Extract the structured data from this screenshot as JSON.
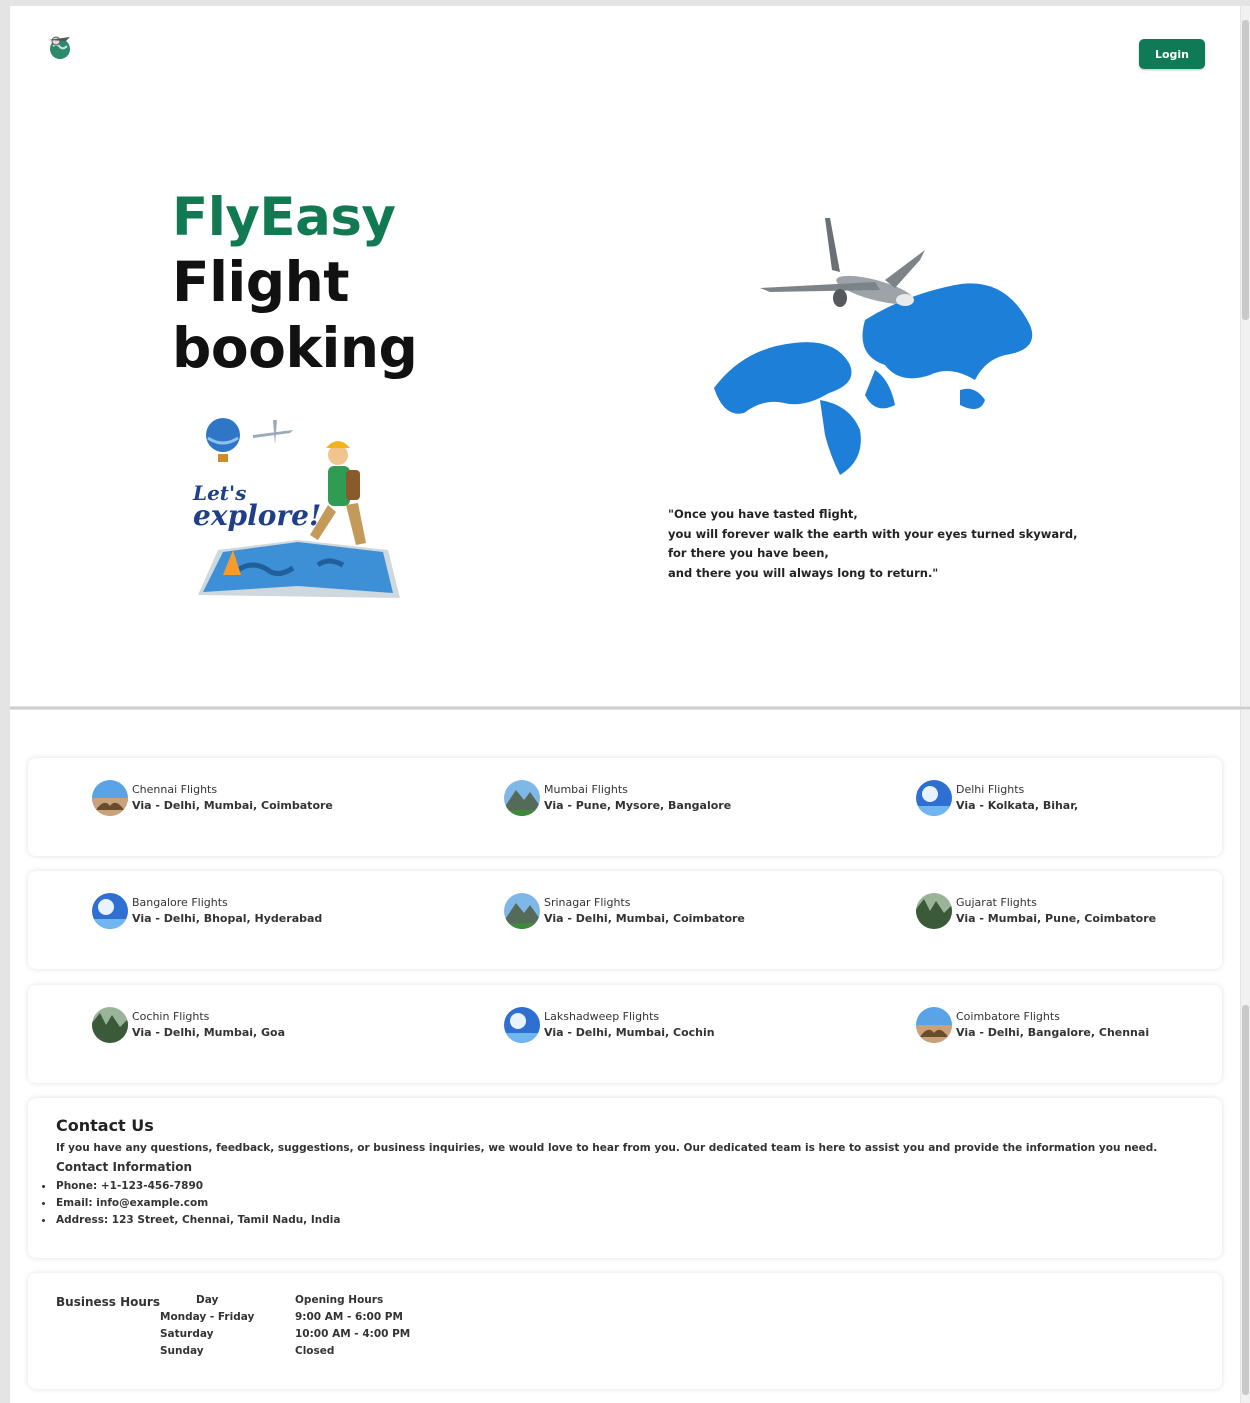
{
  "header": {
    "logo_icon": "airplane-globe-icon",
    "login_label": "Login"
  },
  "hero": {
    "brand": "FlyEasy",
    "title_line1": "Flight",
    "title_line2": "booking",
    "illustration_text": "Let's explore!",
    "quote": [
      "\"Once you have tasted flight,",
      "you will forever walk the earth with your eyes turned skyward,",
      "for there you have been,",
      "and there you will always long to return.\""
    ]
  },
  "routes": [
    [
      {
        "title": "Chennai Flights",
        "via": "Via - Delhi, Mumbai, Coimbatore",
        "img": "beach"
      },
      {
        "title": "Mumbai Flights",
        "via": "Via - Pune, Mysore, Bangalore",
        "img": "mountain"
      },
      {
        "title": "Delhi Flights",
        "via": "Via - Kolkata, Bihar,",
        "img": "sky"
      }
    ],
    [
      {
        "title": "Bangalore Flights",
        "via": "Via - Delhi, Bhopal, Hyderabad",
        "img": "sky"
      },
      {
        "title": "Srinagar Flights",
        "via": "Via - Delhi, Mumbai, Coimbatore",
        "img": "mountain"
      },
      {
        "title": "Gujarat Flights",
        "via": "Via - Mumbai, Pune, Coimbatore",
        "img": "forest"
      }
    ],
    [
      {
        "title": "Cochin Flights",
        "via": "Via - Delhi, Mumbai, Goa",
        "img": "forest"
      },
      {
        "title": "Lakshadweep Flights",
        "via": "Via - Delhi, Mumbai, Cochin",
        "img": "sky"
      },
      {
        "title": "Coimbatore Flights",
        "via": "Via - Delhi, Bangalore, Chennai",
        "img": "beach"
      }
    ]
  ],
  "contact": {
    "heading": "Contact Us",
    "intro": "If you have any questions, feedback, suggestions, or business inquiries, we would love to hear from you. Our dedicated team is here to assist you and provide the information you need.",
    "info_heading": "Contact Information",
    "phone": "Phone: +1-123-456-7890",
    "email": "Email: info@example.com",
    "address": "Address: 123 Street, Chennai, Tamil Nadu, India"
  },
  "hours": {
    "title": "Business Hours",
    "col_day": "Day",
    "col_hours": "Opening Hours",
    "rows": [
      {
        "day": "Monday - Friday",
        "time": "9:00 AM - 6:00 PM"
      },
      {
        "day": "Saturday",
        "time": "10:00 AM - 4:00 PM"
      },
      {
        "day": "Sunday",
        "time": "Closed"
      }
    ]
  },
  "colors": {
    "brand_green": "#117a52",
    "button_green": "#0e7a56",
    "map_blue": "#1e7fd9"
  }
}
